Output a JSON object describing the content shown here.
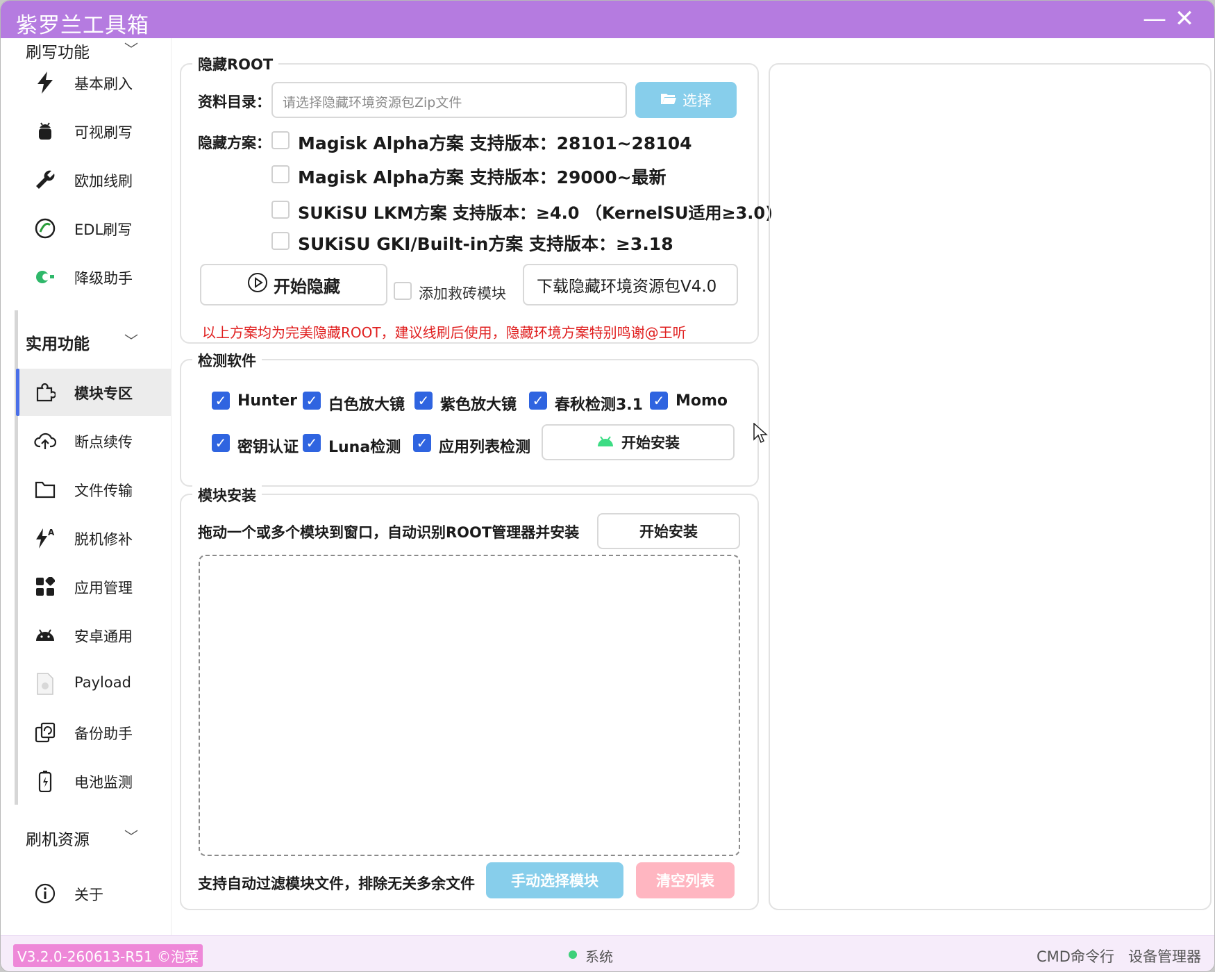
{
  "window": {
    "title": "紫罗兰工具箱",
    "minimize_glyph": "—",
    "close_glyph": "✕"
  },
  "sidebar": {
    "top_group_label": "刷写功能",
    "flash_items": [
      {
        "label": "基本刷入",
        "icon": "lightning-icon"
      },
      {
        "label": "可视刷写",
        "icon": "android-robot-icon"
      },
      {
        "label": "欧加线刷",
        "icon": "wrench-icon"
      },
      {
        "label": "EDL刷写",
        "icon": "edl-icon"
      },
      {
        "label": "降级助手",
        "icon": "downgrade-icon"
      }
    ],
    "util_group_label": "实用功能",
    "util_items": [
      {
        "label": "模块专区",
        "icon": "puzzle-icon"
      },
      {
        "label": "断点续传",
        "icon": "cloud-upload-icon"
      },
      {
        "label": "文件传输",
        "icon": "folder-icon"
      },
      {
        "label": "脱机修补",
        "icon": "patch-icon"
      },
      {
        "label": "应用管理",
        "icon": "apps-grid-icon"
      },
      {
        "label": "安卓通用",
        "icon": "android-head-icon"
      },
      {
        "label": "Payload",
        "icon": "file-icon"
      },
      {
        "label": "备份助手",
        "icon": "backup-icon"
      },
      {
        "label": "电池监测",
        "icon": "battery-icon"
      }
    ],
    "resource_group_label": "刷机资源",
    "about_label": "关于"
  },
  "hide_root": {
    "legend": "隐藏ROOT",
    "dir_label": "资料目录：",
    "dir_placeholder": "请选择隐藏环境资源包Zip文件",
    "choose_label": "选择",
    "scheme_label": "隐藏方案：",
    "schemes": [
      "Magisk Alpha方案  支持版本：28101~28104",
      "Magisk Alpha方案  支持版本：29000~最新",
      "SUKiSU LKM方案  支持版本：≥4.0  （KernelSU适用≥3.0)",
      "SUKiSU GKI/Built-in方案  支持版本：≥3.18"
    ],
    "start_label": "开始隐藏",
    "rescue_label": "添加救砖模块",
    "download_label": "下载隐藏环境资源包V4.0",
    "notice": "以上方案均为完美隐藏ROOT，建议线刷后使用，隐藏环境方案特别鸣谢@王听",
    "notice_color": "#e02020"
  },
  "detect": {
    "legend": "检测软件",
    "apps": [
      "Hunter",
      "白色放大镜",
      "紫色放大镜",
      "春秋检测3.1",
      "Momo",
      "密钥认证",
      "Luna检测",
      "应用列表检测"
    ],
    "install_label": "开始安装"
  },
  "module": {
    "legend": "模块安装",
    "hint": "拖动一个或多个模块到窗口，自动识别ROOT管理器并安装",
    "install_label": "开始安装",
    "filter_hint": "支持自动过滤模块文件，排除无关多余文件",
    "manual_label": "手动选择模块",
    "clear_label": "清空列表"
  },
  "status": {
    "version": "V3.2.0-260613-R51 ©泡菜",
    "system": "系统",
    "cmd": "CMD命令行",
    "devmgr": "设备管理器"
  },
  "colors": {
    "title_bar": "#b57be0",
    "accent": "#2f64e0",
    "choose_btn": "#87ceeb",
    "clear_btn": "#ffb6c1"
  }
}
